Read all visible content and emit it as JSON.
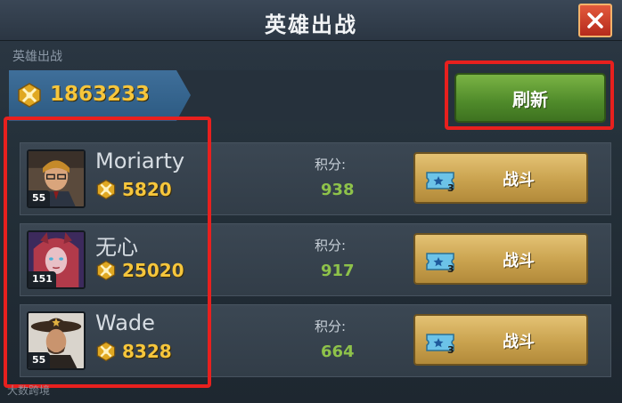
{
  "window": {
    "title": "英雄出战",
    "close_icon": "close-icon",
    "accent": "#e8201e"
  },
  "header": {
    "subtitle": "英雄出战",
    "power_icon": "power-emblem-icon",
    "power": "1863233",
    "refresh_label": "刷新"
  },
  "opponents": [
    {
      "name": "Moriarty",
      "level": "55",
      "power": "5820",
      "score_label": "积分:",
      "score": "938",
      "ticket_count": "3",
      "battle_label": "战斗",
      "avatar_icon": "hero-portrait-moriarty"
    },
    {
      "name": "无心",
      "level": "151",
      "power": "25020",
      "score_label": "积分:",
      "score": "917",
      "ticket_count": "3",
      "battle_label": "战斗",
      "avatar_icon": "hero-portrait-wuxin"
    },
    {
      "name": "Wade",
      "level": "55",
      "power": "8328",
      "score_label": "积分:",
      "score": "664",
      "ticket_count": "3",
      "battle_label": "战斗",
      "avatar_icon": "hero-portrait-wade"
    }
  ],
  "watermark": "大数跨境"
}
